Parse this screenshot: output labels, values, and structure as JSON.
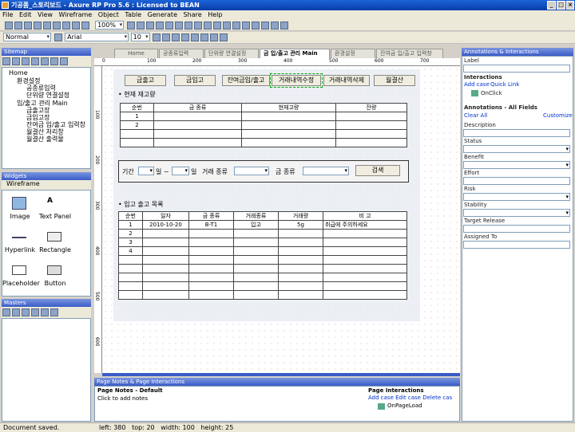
{
  "window": {
    "title": "기공품_스토리보드 - Axure RP Pro 5.6 : Licensed to BEAN"
  },
  "menu": [
    "File",
    "Edit",
    "View",
    "Wireframe",
    "Object",
    "Table",
    "Generate",
    "Share",
    "Help"
  ],
  "toolbar": {
    "zoom": "100%",
    "style": "Normal",
    "font": "Arial",
    "size": "10"
  },
  "sitemap": {
    "title": "Sitemap",
    "items": [
      "Home",
      "환경설정",
      "공종류입력",
      "단위량 연결설정",
      "입/출고 관리 Main",
      "금출고장",
      "금입고장",
      "잔여금 입/출고 입력창",
      "월결산 처리창",
      "월결산 출력물"
    ]
  },
  "widgets": {
    "title": "Widgets",
    "library": "Wireframe",
    "items": [
      "Image",
      "Text Panel",
      "Hyperlink",
      "Rectangle",
      "Placeholder",
      "Button"
    ]
  },
  "masters": {
    "title": "Masters"
  },
  "tabs": [
    "Home",
    "공종류입력",
    "단위량 연결설정",
    "금 입/출고 관리 Main",
    "환경설정",
    "잔여금 입/출고 입력창"
  ],
  "ruler": {
    "h": [
      "0",
      "100",
      "200",
      "300",
      "400",
      "500",
      "600",
      "700"
    ],
    "v": [
      "100",
      "200",
      "300",
      "400",
      "500",
      "600"
    ]
  },
  "canvas": {
    "nav_buttons": [
      "금출고",
      "금입고",
      "잔여금입/출고",
      "거래내역수정",
      "거래내역삭제",
      "월결산"
    ],
    "section1": "• 현재 재고량",
    "stock_headers": [
      "순번",
      "금 종류",
      "현재고량",
      "잔량"
    ],
    "stock_rows": [
      [
        "1",
        "",
        "",
        ""
      ],
      [
        "2",
        "",
        "",
        ""
      ],
      [
        "",
        "",
        "",
        ""
      ],
      [
        "",
        "",
        "",
        ""
      ]
    ],
    "filter": {
      "period": "기간",
      "tilde": "일 ~",
      "day": "일",
      "trade_type": "거래 종류",
      "gold_type": "금 종류",
      "search": "검색"
    },
    "section2": "• 입고 출고 목록",
    "list_headers": [
      "순번",
      "일자",
      "금 종류",
      "거래종류",
      "거래량",
      "비 고"
    ],
    "list_rows": [
      [
        "1",
        "2010-10-20",
        "B-T1",
        "입고",
        "5g",
        "취급에 주의하세요"
      ],
      [
        "2",
        "",
        "",
        "",
        "",
        ""
      ],
      [
        "3",
        "",
        "",
        "",
        "",
        ""
      ],
      [
        "4",
        "",
        "",
        "",
        "",
        ""
      ],
      [
        "",
        "",
        "",
        "",
        "",
        ""
      ],
      [
        "",
        "",
        "",
        "",
        "",
        ""
      ],
      [
        "",
        "",
        "",
        "",
        "",
        ""
      ],
      [
        "",
        "",
        "",
        "",
        "",
        ""
      ],
      [
        "",
        "",
        "",
        "",
        "",
        ""
      ]
    ]
  },
  "annotations": {
    "title": "Annotations & Interactions",
    "label": "Label",
    "interactions": "Interactions",
    "add_case": "Add case",
    "quick_link": "Quick Link",
    "onclick": "OnClick",
    "fields_title": "Annotations - All Fields",
    "clear_all": "Clear All",
    "customize": "Customize",
    "fields": [
      "Description",
      "Status",
      "Benefit",
      "Effort",
      "Risk",
      "Stability",
      "Target Release",
      "Assigned To"
    ]
  },
  "notes": {
    "title": "Page Notes & Page Interactions",
    "notes_label": "Page Notes - Default",
    "placeholder": "Click to add notes",
    "interactions": "Page Interactions",
    "actions": "Add case Edit case Delete cas",
    "onpageload": "OnPageLoad"
  },
  "status": {
    "message": "Document saved.",
    "coords": "left: 380   top: 20   width: 100   height: 25"
  }
}
